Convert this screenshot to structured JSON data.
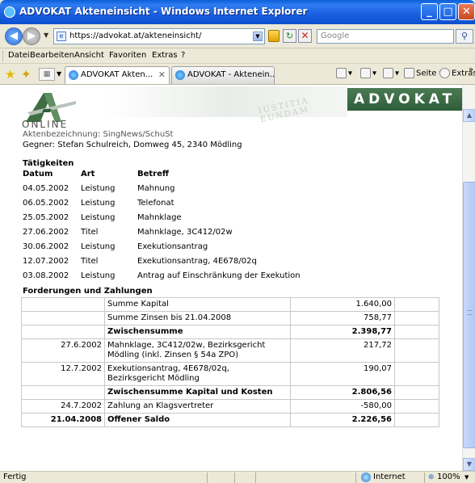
{
  "window": {
    "title": "ADVOKAT Akteneinsicht - Windows Internet Explorer",
    "minimize_glyph": "_",
    "maximize_glyph": "□",
    "close_glyph": "✕"
  },
  "addressbar": {
    "url": "https://advokat.at/akteneinsicht/",
    "search_placeholder": "Google",
    "back_glyph": "◀",
    "forward_glyph": "▶",
    "refresh_glyph": "↻",
    "stop_glyph": "✕",
    "search_glyph": "⚲"
  },
  "menu": {
    "items": [
      "Datei",
      "Bearbeiten",
      "Ansicht",
      "Favoriten",
      "Extras",
      "?"
    ]
  },
  "tabs": {
    "items": [
      {
        "label": "ADVOKAT Akten...",
        "active": true
      },
      {
        "label": "ADVOKAT - Aktenein...",
        "active": false
      }
    ],
    "close_glyph": "✕"
  },
  "toolbar": {
    "page_label": "Seite",
    "extras_label": "Extras",
    "overflow": "»"
  },
  "page": {
    "brand": "ADVOKAT",
    "logo_subtitle": "ONLINE",
    "watermark": "IUSTITIA EUNDAM",
    "aktenbezeichnung": "Aktenbezeichnung: SingNews/SchuSt",
    "gegner": "Gegner: Stefan Schulreich, Domweg 45, 2340 Mödling",
    "activities_title": "Tätigkeiten",
    "activities_headers": [
      "Datum",
      "Art",
      "Betreff"
    ],
    "activities": [
      {
        "datum": "04.05.2002",
        "art": "Leistung",
        "betreff": "Mahnung"
      },
      {
        "datum": "06.05.2002",
        "art": "Leistung",
        "betreff": "Telefonat"
      },
      {
        "datum": "25.05.2002",
        "art": "Leistung",
        "betreff": "Mahnklage"
      },
      {
        "datum": "27.06.2002",
        "art": "Titel",
        "betreff": "Mahnklage, 3C412/02w"
      },
      {
        "datum": "30.06.2002",
        "art": "Leistung",
        "betreff": "Exekutionsantrag"
      },
      {
        "datum": "12.07.2002",
        "art": "Titel",
        "betreff": "Exekutionsantrag, 4E678/02q"
      },
      {
        "datum": "03.08.2002",
        "art": "Leistung",
        "betreff": "Antrag auf Einschränkung der Exekution"
      }
    ],
    "claims_title": "Forderungen und Zahlungen",
    "claims": [
      {
        "date": "",
        "desc": "Summe Kapital",
        "amount": "1.640,00",
        "bold": false
      },
      {
        "date": "",
        "desc": "Summe Zinsen bis 21.04.2008",
        "amount": "758,77",
        "bold": false
      },
      {
        "date": "",
        "desc": "Zwischensumme",
        "amount": "2.398,77",
        "bold": true
      },
      {
        "date": "27.6.2002",
        "desc": "Mahnklage, 3C412/02w, Bezirksgericht Mödling (inkl. Zinsen § 54a ZPO)",
        "amount": "217,72",
        "bold": false
      },
      {
        "date": "12.7.2002",
        "desc": "Exekutionsantrag, 4E678/02q, Bezirksgericht Mödling",
        "amount": "190,07",
        "bold": false
      },
      {
        "date": "",
        "desc": "Zwischensumme Kapital und Kosten",
        "amount": "2.806,56",
        "bold": true
      },
      {
        "date": "24.7.2002",
        "desc": "Zahlung an Klagsvertreter",
        "amount": "-580,00",
        "bold": false
      },
      {
        "date": "21.04.2008",
        "desc": "Offener Saldo",
        "amount": "2.226,56",
        "bold": true
      }
    ]
  },
  "statusbar": {
    "status": "Fertig",
    "zone": "Internet",
    "zoom": "100%"
  },
  "colors": {
    "titlebar": "#1a5fe0",
    "brand_bg": "#2f5e3a",
    "chrome": "#ece9d8"
  }
}
